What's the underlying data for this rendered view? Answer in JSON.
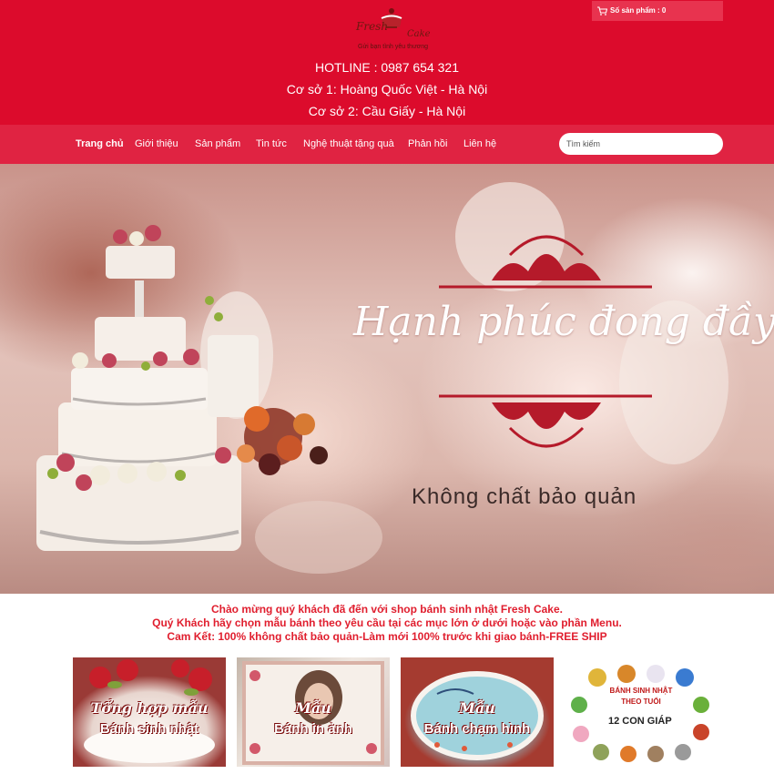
{
  "brand": {
    "logo_text_1": "Fresh",
    "logo_text_2": "Cake",
    "tagline": "Gửi bạn tình yêu thương"
  },
  "cart": {
    "icon": "cart-icon",
    "label": "Số sản phẩm : 0"
  },
  "contact": {
    "hotline": "HOTLINE : 0987 654 321",
    "branch_1": "Cơ sở 1: Hoàng Quốc Việt - Hà Nội",
    "branch_2": "Cơ sở 2: Cầu Giấy - Hà Nội"
  },
  "nav": {
    "items": [
      {
        "label": "Trang chủ",
        "active": true
      },
      {
        "label": "Giới thiệu"
      },
      {
        "label": "Sản phẩm"
      },
      {
        "label": "Tin tức"
      },
      {
        "label": "Nghệ thuật tặng quà"
      },
      {
        "label": "Phản hồi"
      },
      {
        "label": "Liên hệ"
      }
    ],
    "search_placeholder": "Tìm kiếm"
  },
  "hero": {
    "headline": "Hạnh phúc đong đầy",
    "subline": "Không chất bảo quản"
  },
  "welcome": {
    "line_1": "Chào mừng quý khách đã đến với shop bánh sinh nhật Fresh Cake.",
    "line_2": "Quý Khách hãy chọn mẫu bánh theo yêu cầu tại các mục lớn ở dưới hoặc vào phần Menu.",
    "line_3": "Cam Kết: 100% không chất bảo quản-Làm mới 100% trước khi giao bánh-FREE SHIP"
  },
  "categories": [
    {
      "line_1": "Tổng hợp mẫu",
      "line_2": "Bánh sinh nhật"
    },
    {
      "line_1": "Mẫu",
      "line_2": "Bánh in ảnh"
    },
    {
      "line_1": "Mẫu",
      "line_2": "Bánh chạm hình"
    },
    {
      "line_1": "BÁNH SINH NHẬT",
      "line_2": "THEO TUỔI",
      "line_3": "12 CON GIÁP"
    }
  ],
  "colors": {
    "header_red": "#dc0b2c",
    "nav_red": "#e02342",
    "welcome_red": "#e01e2e"
  }
}
